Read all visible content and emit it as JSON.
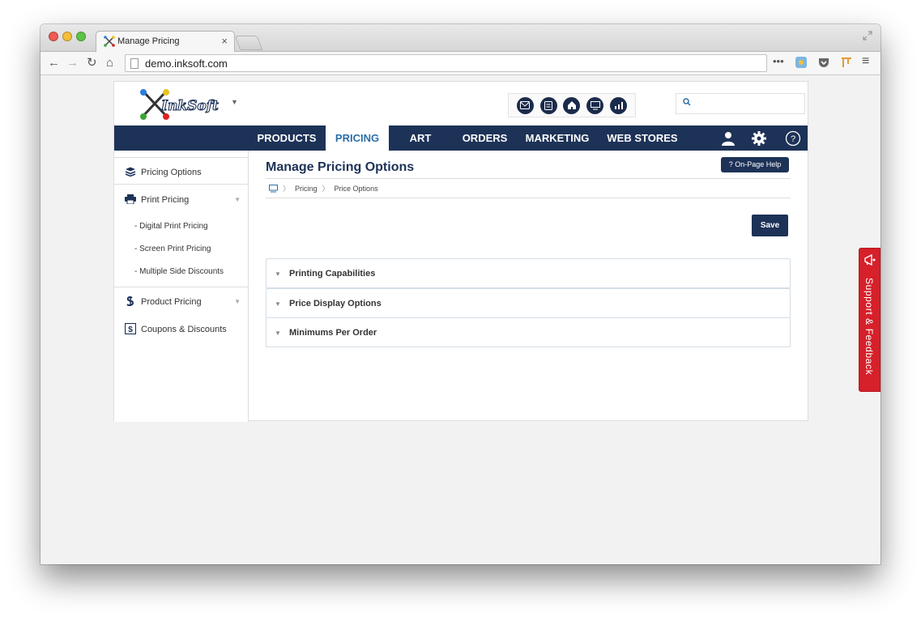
{
  "browser": {
    "tab_title": "Manage Pricing",
    "tab_close": "×",
    "url": "demo.inksoft.com",
    "overflow_label": "•••"
  },
  "nav": {
    "items": [
      {
        "label": "PRODUCTS"
      },
      {
        "label": "PRICING"
      },
      {
        "label": "ART"
      },
      {
        "label": "ORDERS"
      },
      {
        "label": "MARKETING"
      },
      {
        "label": "WEB STORES"
      }
    ],
    "active": "PRICING"
  },
  "sidebar": {
    "items": [
      {
        "label": "Pricing Options",
        "icon": "stack-icon"
      },
      {
        "label": "Print Pricing",
        "icon": "printer-icon"
      },
      {
        "label": "Product Pricing",
        "icon": "dollar-icon"
      },
      {
        "label": "Coupons & Discounts",
        "icon": "coupon-icon"
      }
    ],
    "print_sub": [
      {
        "label": "Digital Print Pricing"
      },
      {
        "label": "Screen Print Pricing"
      },
      {
        "label": "Multiple Side Discounts"
      }
    ]
  },
  "page": {
    "title": "Manage Pricing Options",
    "help_label": "? On-Page Help",
    "breadcrumb": [
      "Pricing",
      "Price Options"
    ],
    "save_label": "Save",
    "panels": [
      {
        "label": "Printing Capabilities"
      },
      {
        "label": "Price Display Options"
      },
      {
        "label": "Minimums Per Order"
      }
    ]
  },
  "support": {
    "label": "Support & Feedback"
  },
  "colors": {
    "nav_bg": "#1d3257",
    "active_tab_text": "#2c6ea8",
    "support_red": "#d6202a"
  }
}
